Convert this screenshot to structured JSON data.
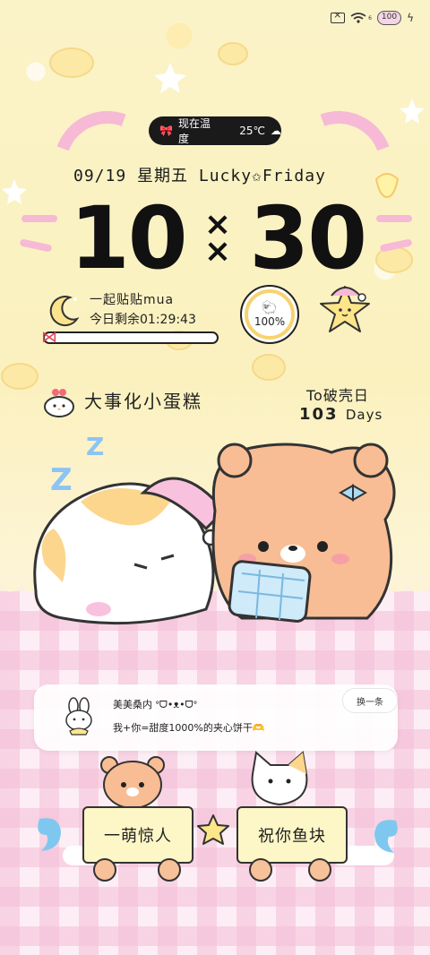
{
  "status_bar": {
    "net_speed": "6",
    "battery_level": "100"
  },
  "weather": {
    "label": "现在温度",
    "temperature": "25℃"
  },
  "date": {
    "text": "09/19 星期五 Lucky✩Friday"
  },
  "clock": {
    "hours": "10",
    "minutes": "30"
  },
  "countdown": {
    "title": "一起贴贴mua",
    "remaining": "今日剩余01:29:43",
    "progress": 0.0
  },
  "battery_widget": {
    "value": "100%"
  },
  "slogan": {
    "text": "大事化小蛋糕"
  },
  "anniversary": {
    "label": "To破壳日",
    "count": "103",
    "unit": "Days"
  },
  "notification": {
    "sender": "美美桑内 ᐤᗜ•ᴥ•ᗜᐤ",
    "message": "我+你=甜度1000%的夹心饼干🫶",
    "action_label": "换一条"
  },
  "shortcuts": {
    "left_label": "一萌惊人",
    "right_label": "祝你鱼块"
  },
  "colors": {
    "accent_pink": "#f6b9d6",
    "accent_yellow": "#f7d370",
    "ink": "#1a1a1a"
  }
}
